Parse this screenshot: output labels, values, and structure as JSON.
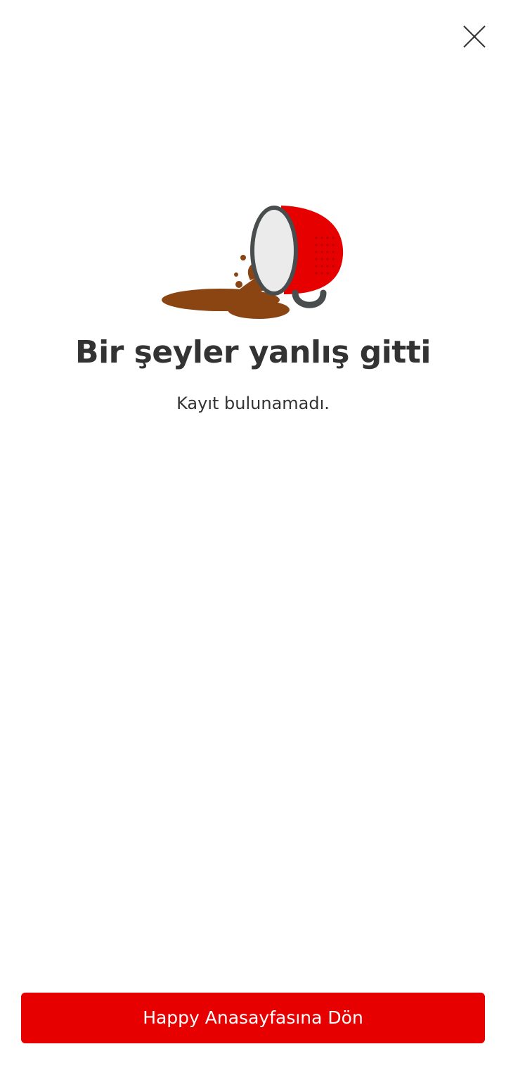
{
  "header": {
    "close_icon": "close-icon"
  },
  "illustration": {
    "icon": "spilled-coffee-cup-icon",
    "colors": {
      "cup": "#e60000",
      "rim": "#4a4d4e",
      "inside": "#ebebeb",
      "coffee": "#8b4513"
    }
  },
  "error": {
    "title": "Bir şeyler yanlış gitti",
    "message": "Kayıt bulunamadı."
  },
  "footer": {
    "button_label": "Happy Anasayfasına Dön",
    "button_color": "#e60000"
  }
}
